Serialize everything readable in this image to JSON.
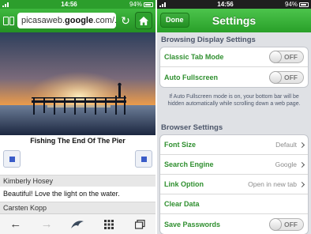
{
  "left_status": {
    "time": "14:56",
    "battery": "94%"
  },
  "browser": {
    "url_prefix": "picasaweb.",
    "url_domain": "google",
    "url_suffix": ".com/...",
    "photo_caption": "Fishing The End Of The Pier",
    "comments": [
      {
        "author": "Kimberly Hosey",
        "text": "Beautiful! Love the light on the water."
      },
      {
        "author": "Carsten Kopp",
        "text": ""
      }
    ],
    "icons": [
      "bookmarks-icon",
      "reload-icon",
      "home-icon",
      "back-arrow-icon",
      "forward-arrow-icon",
      "dolphin-icon",
      "grid-icon",
      "tabs-icon"
    ]
  },
  "right_status": {
    "time": "14:56",
    "battery": "94%"
  },
  "settings": {
    "done_label": "Done",
    "title": "Settings",
    "browsing_header": "Browsing Display Settings",
    "classic_tab_mode": {
      "label": "Classic Tab Mode",
      "state": "OFF"
    },
    "auto_fullscreen": {
      "label": "Auto Fullscreen",
      "state": "OFF"
    },
    "fullscreen_note": "If Auto Fullscreen mode is on, your bottom bar will be hidden automatically while scrolling down a web page.",
    "browser_header": "Browser Settings",
    "font_size": {
      "label": "Font Size",
      "value": "Default"
    },
    "search_engine": {
      "label": "Search Engine",
      "value": "Google"
    },
    "link_option": {
      "label": "Link Option",
      "value": "Open in new tab"
    },
    "clear_data": {
      "label": "Clear Data"
    },
    "save_passwords": {
      "label": "Save Passwords",
      "state": "OFF"
    }
  },
  "colors": {
    "accent_green": "#2ea02e",
    "label_green": "#2f8f2f"
  }
}
